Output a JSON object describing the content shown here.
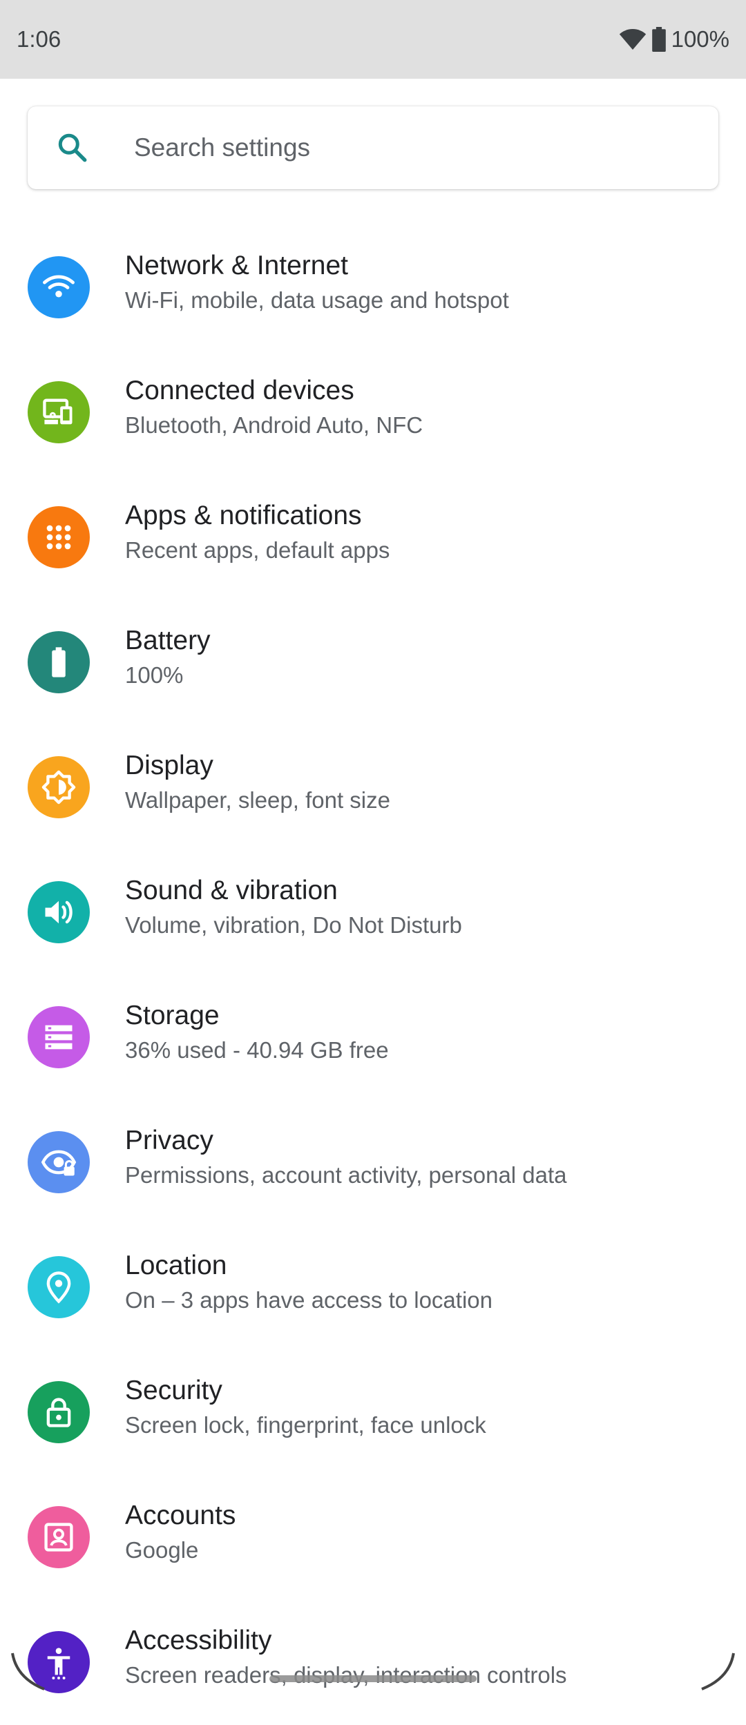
{
  "status_bar": {
    "time": "1:06",
    "battery_percent": "100%",
    "icons": [
      "wifi-icon",
      "battery-icon"
    ]
  },
  "search": {
    "placeholder": "Search settings",
    "icon": "search-icon",
    "icon_color": "#1a8a8a"
  },
  "settings": [
    {
      "id": "network",
      "title": "Network & Internet",
      "subtitle": "Wi-Fi, mobile, data usage and hotspot",
      "icon": "wifi-icon",
      "color": "#2196f3"
    },
    {
      "id": "connected",
      "title": "Connected devices",
      "subtitle": "Bluetooth, Android Auto, NFC",
      "icon": "devices-icon",
      "color": "#72b61c"
    },
    {
      "id": "apps",
      "title": "Apps & notifications",
      "subtitle": "Recent apps, default apps",
      "icon": "apps-grid-icon",
      "color": "#f8790f"
    },
    {
      "id": "battery",
      "title": "Battery",
      "subtitle": "100%",
      "icon": "battery-icon",
      "color": "#23877a"
    },
    {
      "id": "display",
      "title": "Display",
      "subtitle": "Wallpaper, sleep, font size",
      "icon": "brightness-icon",
      "color": "#f9a51e"
    },
    {
      "id": "sound",
      "title": "Sound & vibration",
      "subtitle": "Volume, vibration, Do Not Disturb",
      "icon": "volume-icon",
      "color": "#12b1a9"
    },
    {
      "id": "storage",
      "title": "Storage",
      "subtitle": "36% used - 40.94 GB free",
      "icon": "storage-icon",
      "color": "#c55be7"
    },
    {
      "id": "privacy",
      "title": "Privacy",
      "subtitle": "Permissions, account activity, personal data",
      "icon": "privacy-eye-icon",
      "color": "#5b8ff0"
    },
    {
      "id": "location",
      "title": "Location",
      "subtitle": "On – 3 apps have access to location",
      "icon": "location-pin-icon",
      "color": "#26c6da"
    },
    {
      "id": "security",
      "title": "Security",
      "subtitle": "Screen lock, fingerprint, face unlock",
      "icon": "lock-icon",
      "color": "#17a05d"
    },
    {
      "id": "accounts",
      "title": "Accounts",
      "subtitle": "Google",
      "icon": "account-icon",
      "color": "#ef5d9d"
    },
    {
      "id": "accessibility",
      "title": "Accessibility",
      "subtitle": "Screen readers, display, interaction controls",
      "icon": "accessibility-icon",
      "color": "#5321c5"
    }
  ]
}
